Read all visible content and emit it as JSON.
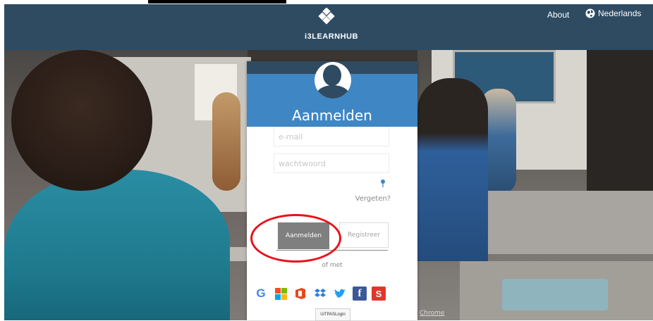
{
  "header": {
    "brand": "i3LEARNHUB",
    "about_label": "About",
    "language_label": "Nederlands",
    "colors": {
      "header_bg": "#2e4b62",
      "accent_blue": "#3f86c5"
    }
  },
  "login": {
    "title": "Aanmelden",
    "email_placeholder": "e-mail",
    "password_placeholder": "wachtwoord",
    "forgot_label": "Vergeten?",
    "login_button": "Aanmelden",
    "register_button": "Registreer",
    "or_with": "of met",
    "social": [
      "google-icon",
      "microsoft-icon",
      "office-icon",
      "dropbox-icon",
      "twitter-icon",
      "facebook-icon",
      "smartschool-icon"
    ],
    "uitpas_label": "UiTPASLogin"
  },
  "footer": {
    "chrome_link": "Chrome"
  },
  "icons": {
    "fb_glyph": "f",
    "s_glyph": "S",
    "g_glyph": "G"
  }
}
